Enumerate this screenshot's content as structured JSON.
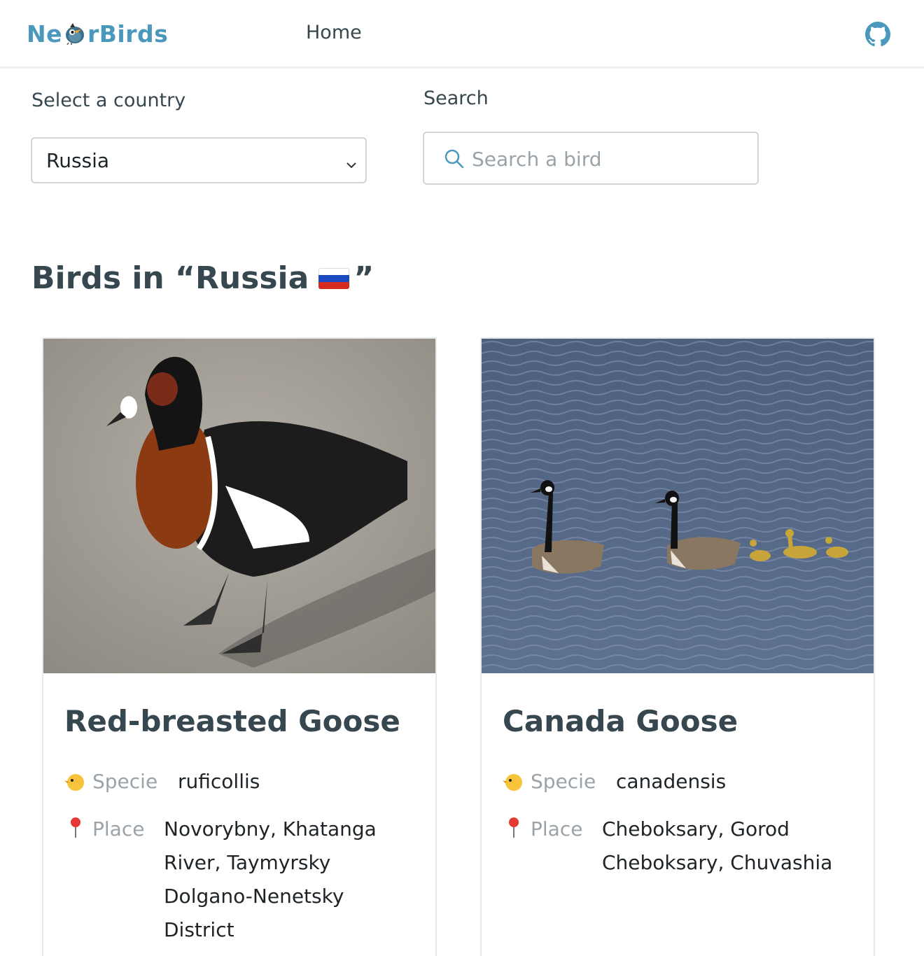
{
  "header": {
    "logo_text_left": "Ne",
    "logo_text_right": "rBirds",
    "nav_home": "Home",
    "github_icon": "github-icon"
  },
  "filters": {
    "country_label": "Select a country",
    "country_value": "Russia",
    "search_label": "Search",
    "search_placeholder": "Search a bird",
    "search_value": ""
  },
  "page": {
    "heading_prefix": "Birds in “Russia",
    "heading_suffix": "”",
    "flag_colors": [
      "#ffffff",
      "#1a4ac2",
      "#d52b1e"
    ]
  },
  "cards": [
    {
      "name": "Red-breasted Goose",
      "specie_label": "Specie",
      "specie": "ruficollis",
      "place_label": "Place",
      "place": "Novorybny, Khatanga River, Taymyrsky Dolgano-Nenetsky District"
    },
    {
      "name": "Canada Goose",
      "specie_label": "Specie",
      "specie": "canadensis",
      "place_label": "Place",
      "place": "Cheboksary, Gorod Cheboksary, Chuvashia"
    }
  ],
  "colors": {
    "brand": "#4b98bd",
    "text": "#37474f",
    "muted": "#9aa3a9"
  }
}
